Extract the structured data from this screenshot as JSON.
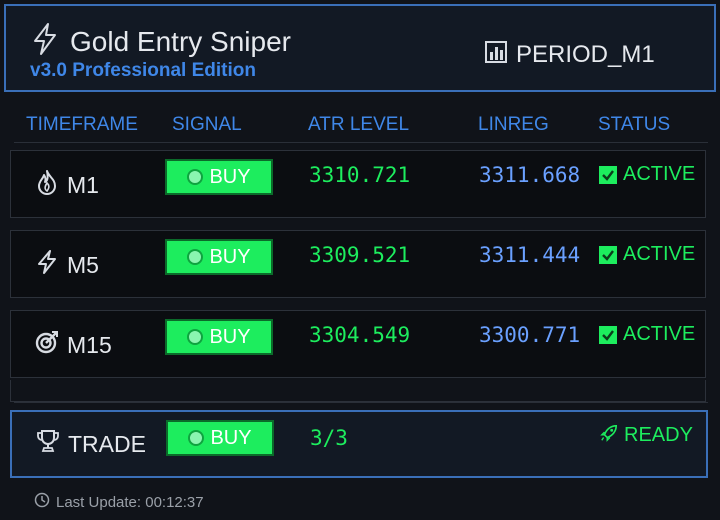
{
  "header": {
    "title": "Gold Entry Sniper",
    "subtitle": "v3.0 Professional Edition",
    "period": "PERIOD_M1"
  },
  "columns": [
    "TIMEFRAME",
    "SIGNAL",
    "ATR LEVEL",
    "LINREG",
    "STATUS"
  ],
  "rows": [
    {
      "timeframe": "M1",
      "icon": "flame-icon",
      "signal": "BUY",
      "atr": "3310.721",
      "linreg": "3311.668",
      "status": "ACTIVE"
    },
    {
      "timeframe": "M5",
      "icon": "lightning-icon",
      "signal": "BUY",
      "atr": "3309.521",
      "linreg": "3311.444",
      "status": "ACTIVE"
    },
    {
      "timeframe": "M15",
      "icon": "target-icon",
      "signal": "BUY",
      "atr": "3304.549",
      "linreg": "3300.771",
      "status": "ACTIVE"
    }
  ],
  "trade": {
    "label": "TRADE",
    "signal": "BUY",
    "count": "3/3",
    "status": "READY"
  },
  "footer": {
    "last_update": "Last Update: 00:12:37"
  },
  "colors": {
    "accent_blue": "#3f87e8",
    "signal_green": "#1ded5e",
    "linreg_blue": "#6aa0ff",
    "background": "#101319"
  }
}
